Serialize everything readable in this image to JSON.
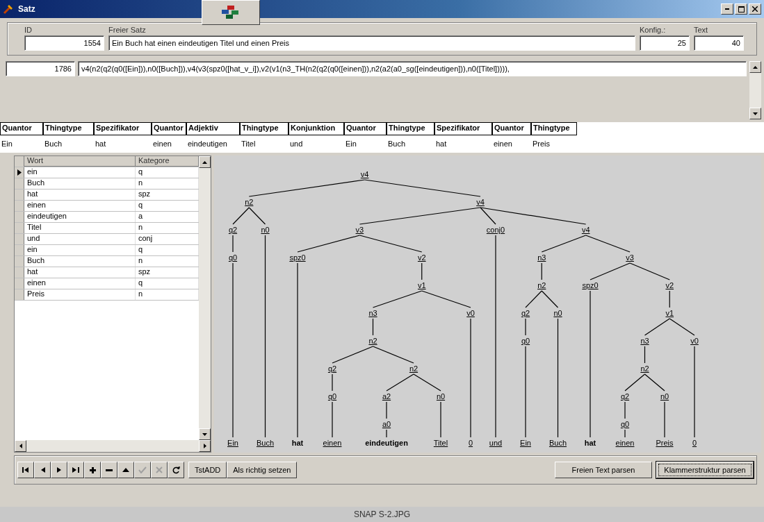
{
  "window": {
    "title": "Satz"
  },
  "header_fields": [
    {
      "label": "ID",
      "value": "1554",
      "kind": "number"
    },
    {
      "label": "Freier Satz",
      "value": "Ein Buch hat einen eindeutigen Titel und einen Preis",
      "kind": "text"
    },
    {
      "label": "Konfig.:",
      "value": "25",
      "kind": "number"
    },
    {
      "label": "Text",
      "value": "40",
      "kind": "number"
    }
  ],
  "structure": {
    "id": "1786",
    "value": "v4(n2(q2(q0([Ein])),n0([Buch])),v4(v3(spz0([hat_v_i]),v2(v1(n3_TH(n2(q2(q0([einen])),n2(a2(a0_sg([eindeutigen])),n0([Titel])))),"
  },
  "phrase_columns": [
    {
      "header": "Quantor",
      "word": "Ein"
    },
    {
      "header": "Thingtype",
      "word": "Buch"
    },
    {
      "header": "Spezifikator",
      "word": "hat"
    },
    {
      "header": "Quantor",
      "word": "einen"
    },
    {
      "header": "Adjektiv",
      "word": "eindeutigen"
    },
    {
      "header": "Thingtype",
      "word": "Titel"
    },
    {
      "header": "Konjunktion",
      "word": "und"
    },
    {
      "header": "Quantor",
      "word": "Ein"
    },
    {
      "header": "Thingtype",
      "word": "Buch"
    },
    {
      "header": "Spezifikator",
      "word": "hat"
    },
    {
      "header": "Quantor",
      "word": "einen"
    },
    {
      "header": "Thingtype",
      "word": "Preis"
    }
  ],
  "word_grid": {
    "columns": [
      "Wort",
      "Kategore"
    ],
    "rows": [
      {
        "cells": [
          "ein",
          "q"
        ],
        "selected": true
      },
      {
        "cells": [
          "Buch",
          "n"
        ],
        "selected": false
      },
      {
        "cells": [
          "hat",
          "spz"
        ],
        "selected": false
      },
      {
        "cells": [
          "einen",
          "q"
        ],
        "selected": false
      },
      {
        "cells": [
          "eindeutigen",
          "a"
        ],
        "selected": false
      },
      {
        "cells": [
          "Titel",
          "n"
        ],
        "selected": false
      },
      {
        "cells": [
          "und",
          "conj"
        ],
        "selected": false
      },
      {
        "cells": [
          "ein",
          "q"
        ],
        "selected": false
      },
      {
        "cells": [
          "Buch",
          "n"
        ],
        "selected": false
      },
      {
        "cells": [
          "hat",
          "spz"
        ],
        "selected": false
      },
      {
        "cells": [
          "einen",
          "q"
        ],
        "selected": false
      },
      {
        "cells": [
          "Preis",
          "n"
        ],
        "selected": false
      }
    ]
  },
  "tree": {
    "label": "v4",
    "children": [
      {
        "label": "n2",
        "children": [
          {
            "label": "q2",
            "children": [
              {
                "label": "q0",
                "children": [
                  {
                    "word": "Ein",
                    "bold": false
                  }
                ]
              }
            ]
          },
          {
            "label": "n0",
            "children": [
              {
                "word": "Buch",
                "bold": false
              }
            ]
          }
        ]
      },
      {
        "label": "v4",
        "children": [
          {
            "label": "v3",
            "children": [
              {
                "label": "spz0",
                "children": [
                  {
                    "word": "hat",
                    "bold": true
                  }
                ]
              },
              {
                "label": "v2",
                "children": [
                  {
                    "label": "v1",
                    "children": [
                      {
                        "label": "n3",
                        "children": [
                          {
                            "label": "n2",
                            "children": [
                              {
                                "label": "q2",
                                "children": [
                                  {
                                    "label": "q0",
                                    "children": [
                                      {
                                        "word": "einen",
                                        "bold": false
                                      }
                                    ]
                                  }
                                ]
                              },
                              {
                                "label": "n2",
                                "children": [
                                  {
                                    "label": "a2",
                                    "children": [
                                      {
                                        "label": "a0",
                                        "children": [
                                          {
                                            "word": "eindeutigen",
                                            "bold": true
                                          }
                                        ]
                                      }
                                    ]
                                  },
                                  {
                                    "label": "n0",
                                    "children": [
                                      {
                                        "word": "Titel",
                                        "bold": false
                                      }
                                    ]
                                  }
                                ]
                              }
                            ]
                          }
                        ]
                      },
                      {
                        "label": "v0",
                        "children": [
                          {
                            "word": "0",
                            "bold": false
                          }
                        ]
                      }
                    ]
                  }
                ]
              }
            ]
          },
          {
            "label": "conj0",
            "children": [
              {
                "word": "und",
                "bold": false
              }
            ]
          },
          {
            "label": "v4",
            "children": [
              {
                "label": "n3",
                "children": [
                  {
                    "label": "n2",
                    "children": [
                      {
                        "label": "q2",
                        "children": [
                          {
                            "label": "q0",
                            "children": [
                              {
                                "word": "Ein",
                                "bold": false
                              }
                            ]
                          }
                        ]
                      },
                      {
                        "label": "n0",
                        "children": [
                          {
                            "word": "Buch",
                            "bold": false
                          }
                        ]
                      }
                    ]
                  }
                ]
              },
              {
                "label": "v3",
                "children": [
                  {
                    "label": "spz0",
                    "children": [
                      {
                        "word": "hat",
                        "bold": true
                      }
                    ]
                  },
                  {
                    "label": "v2",
                    "children": [
                      {
                        "label": "v1",
                        "children": [
                          {
                            "label": "n3",
                            "children": [
                              {
                                "label": "n2",
                                "children": [
                                  {
                                    "label": "q2",
                                    "children": [
                                      {
                                        "label": "q0",
                                        "children": [
                                          {
                                            "word": "einen",
                                            "bold": false
                                          }
                                        ]
                                      }
                                    ]
                                  },
                                  {
                                    "label": "n0",
                                    "children": [
                                      {
                                        "word": "Preis",
                                        "bold": false
                                      }
                                    ]
                                  }
                                ]
                              }
                            ]
                          },
                          {
                            "label": "v0",
                            "children": [
                              {
                                "word": "0",
                                "bold": false
                              }
                            ]
                          }
                        ]
                      }
                    ]
                  }
                ]
              }
            ]
          }
        ]
      }
    ]
  },
  "navigator": [
    {
      "kind": "first",
      "disabled": false
    },
    {
      "kind": "prior",
      "disabled": false
    },
    {
      "kind": "next",
      "disabled": false
    },
    {
      "kind": "last",
      "disabled": false
    },
    {
      "kind": "insert",
      "disabled": false
    },
    {
      "kind": "delete",
      "disabled": false
    },
    {
      "kind": "edit",
      "disabled": false
    },
    {
      "kind": "post",
      "disabled": true
    },
    {
      "kind": "cancel",
      "disabled": true
    },
    {
      "kind": "refresh",
      "disabled": false
    }
  ],
  "left_buttons": [
    {
      "label": "TstADD",
      "focused": false
    },
    {
      "label": "Als richtig setzen",
      "focused": false
    }
  ],
  "right_buttons": [
    {
      "label": "Freien Text parsen",
      "focused": false
    },
    {
      "label": "Klammerstruktur parsen",
      "focused": true
    }
  ],
  "caption": "SNAP S-2.JPG"
}
